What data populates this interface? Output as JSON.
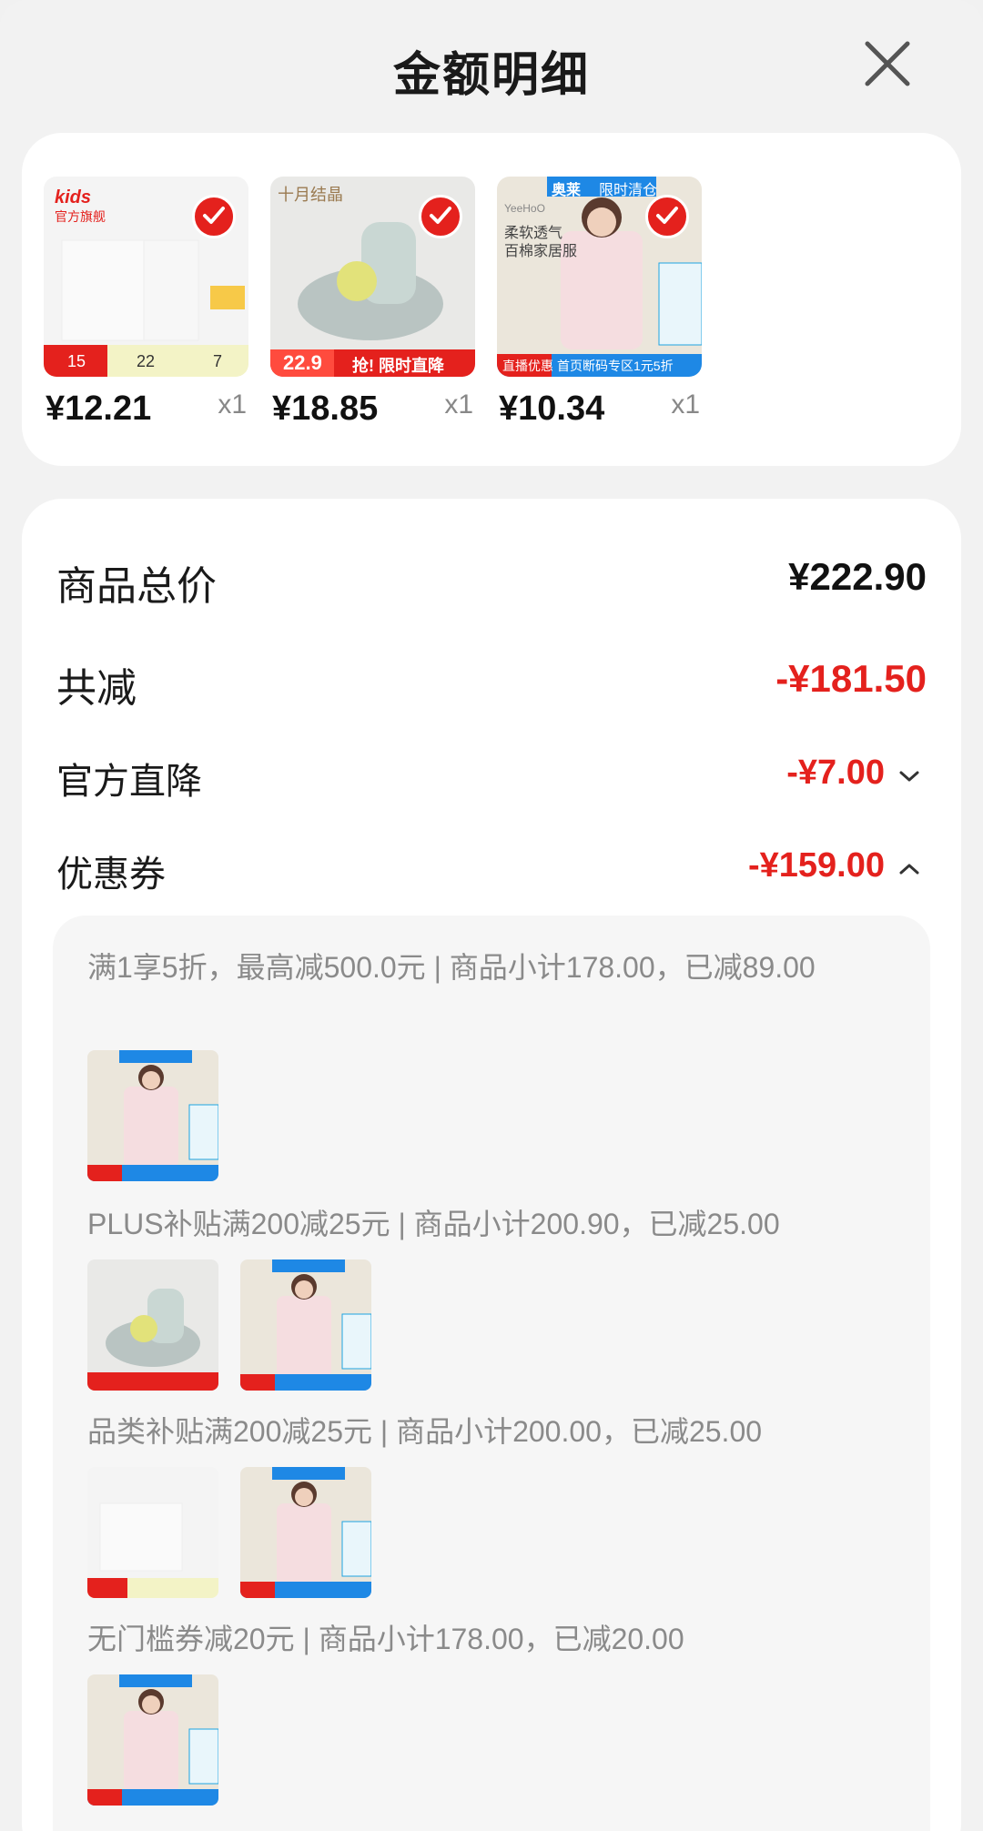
{
  "header": {
    "title": "金额明细"
  },
  "products": [
    {
      "price": "¥12.21",
      "qty": "x1",
      "brand": "kids",
      "brand_sub": "官方旗舰",
      "badge_nums": [
        "15",
        "22",
        "7"
      ]
    },
    {
      "price": "¥18.85",
      "qty": "x1",
      "brand": "十月结晶",
      "promo_price": "22.9",
      "promo_text": "抢! 限时直降"
    },
    {
      "price": "¥10.34",
      "qty": "x1",
      "brand": "YeeHoO",
      "tag1": "奥莱",
      "tag2": "限时清仓",
      "headline": "柔软透气",
      "headline2": "百棉家居服",
      "footer1": "直播优惠",
      "footer2": "首页断码专区1元5折"
    }
  ],
  "summary": {
    "total_label": "商品总价",
    "total_value": "¥222.90",
    "reduce_label": "共减",
    "reduce_value": "-¥181.50",
    "direct_label": "官方直降",
    "direct_value": "-¥7.00",
    "coupon_label": "优惠券",
    "coupon_value": "-¥159.00"
  },
  "coupons": [
    {
      "text": "满1享5折，最高减500.0元 | 商品小计178.00，已减89.00"
    },
    {
      "text": "PLUS补贴满200减25元 | 商品小计200.90，已减25.00"
    },
    {
      "text": "品类补贴满200减25元 | 商品小计200.00，已减25.00"
    },
    {
      "text": "无门槛券减20元 | 商品小计178.00，已减20.00"
    }
  ],
  "colors": {
    "accent_red": "#e4211d",
    "card_bg": "#ffffff",
    "page_bg": "#f2f2f2"
  }
}
